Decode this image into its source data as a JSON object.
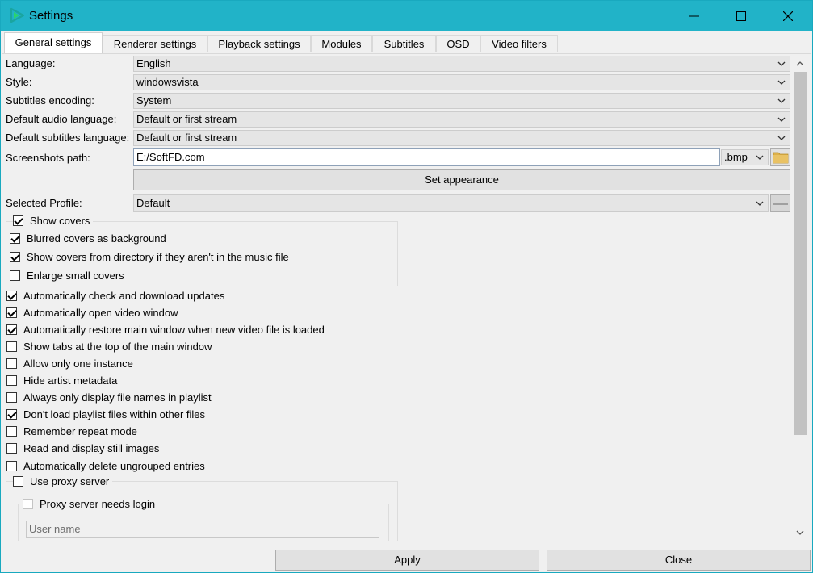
{
  "window": {
    "title": "Settings"
  },
  "tabs": [
    {
      "label": "General settings"
    },
    {
      "label": "Renderer settings"
    },
    {
      "label": "Playback settings"
    },
    {
      "label": "Modules"
    },
    {
      "label": "Subtitles"
    },
    {
      "label": "OSD"
    },
    {
      "label": "Video filters"
    }
  ],
  "form": {
    "language": {
      "label": "Language:",
      "value": "English"
    },
    "style": {
      "label": "Style:",
      "value": "windowsvista"
    },
    "subtitles_encoding": {
      "label": "Subtitles encoding:",
      "value": "System"
    },
    "audio_language": {
      "label": "Default audio language:",
      "value": "Default or first stream"
    },
    "subtitles_language": {
      "label": "Default subtitles language:",
      "value": "Default or first stream"
    },
    "screenshots_path": {
      "label": "Screenshots path:",
      "value": "E:/SoftFD.com",
      "format": ".bmp"
    },
    "set_appearance": "Set appearance",
    "selected_profile": {
      "label": "Selected Profile:",
      "value": "Default"
    }
  },
  "covers": {
    "show_covers": {
      "label": "Show covers",
      "checked": true
    },
    "items": [
      {
        "label": "Blurred covers as background",
        "checked": true
      },
      {
        "label": "Show covers from directory if they aren't in the music file",
        "checked": true
      },
      {
        "label": "Enlarge small covers",
        "checked": false
      }
    ]
  },
  "options": [
    {
      "label": "Automatically check and download updates",
      "checked": true
    },
    {
      "label": "Automatically open video window",
      "checked": true
    },
    {
      "label": "Automatically restore main window when new video file is loaded",
      "checked": true
    },
    {
      "label": "Show tabs at the top of the main window",
      "checked": false
    },
    {
      "label": "Allow only one instance",
      "checked": false
    },
    {
      "label": "Hide artist metadata",
      "checked": false
    },
    {
      "label": "Always only display file names in playlist",
      "checked": false
    },
    {
      "label": "Don't load playlist files within other files",
      "checked": true
    },
    {
      "label": "Remember repeat mode",
      "checked": false
    },
    {
      "label": "Read and display still images",
      "checked": false
    },
    {
      "label": "Automatically delete ungrouped entries",
      "checked": false
    }
  ],
  "proxy": {
    "use_proxy": {
      "label": "Use proxy server",
      "checked": false
    },
    "needs_login": {
      "label": "Proxy server needs login",
      "checked": false
    },
    "username_placeholder": "User name"
  },
  "footer": {
    "apply": "Apply",
    "close": "Close"
  },
  "colors": {
    "titlebar": "#21b3c8",
    "accent": "#1aa5a0",
    "folder": "#dcb04a"
  }
}
